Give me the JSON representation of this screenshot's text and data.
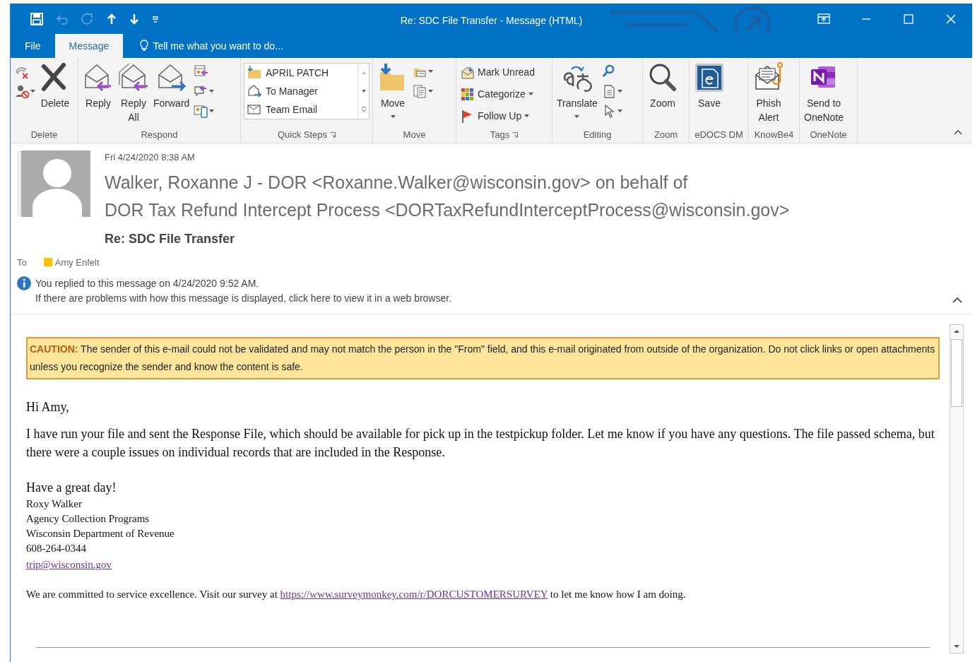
{
  "window": {
    "title": "Re: SDC File Transfer - Message (HTML)"
  },
  "tabs": [
    {
      "label": "File",
      "selected": false
    },
    {
      "label": "Message",
      "selected": true
    }
  ],
  "tell_me": "Tell me what you want to do...",
  "ribbon": [
    {
      "group": "Delete",
      "launcher": false,
      "items": [
        {
          "kind": "icon",
          "dropdown": false
        },
        {
          "kind": "icon",
          "dropdown": true
        },
        {
          "kind": "large",
          "label": "Delete",
          "dropdown": false
        }
      ]
    },
    {
      "group": "Respond",
      "launcher": false,
      "items": [
        {
          "kind": "large",
          "label": "Reply",
          "dropdown": false
        },
        {
          "kind": "large",
          "label": "Reply\nAll",
          "dropdown": false
        },
        {
          "kind": "large",
          "label": "Forward",
          "dropdown": false
        },
        {
          "kind": "icon",
          "dropdown": false
        },
        {
          "kind": "icon",
          "dropdown": true
        },
        {
          "kind": "icon",
          "dropdown": true
        }
      ]
    },
    {
      "group": "Quick Steps",
      "launcher": true,
      "items": [
        {
          "kind": "quickstep",
          "label": "APRIL PATCH"
        },
        {
          "kind": "quickstep",
          "label": "To Manager"
        },
        {
          "kind": "quickstep",
          "label": "Team Email"
        }
      ]
    },
    {
      "group": "Move",
      "launcher": false,
      "items": [
        {
          "kind": "large",
          "label": "Move",
          "dropdown": true
        },
        {
          "kind": "icon",
          "dropdown": true
        },
        {
          "kind": "icon",
          "dropdown": true
        }
      ]
    },
    {
      "group": "Tags",
      "launcher": true,
      "items": [
        {
          "kind": "small",
          "label": "Mark Unread",
          "dropdown": false
        },
        {
          "kind": "small",
          "label": "Categorize",
          "dropdown": true
        },
        {
          "kind": "small",
          "label": "Follow Up",
          "dropdown": true
        }
      ]
    },
    {
      "group": "Editing",
      "launcher": false,
      "items": [
        {
          "kind": "large",
          "label": "Translate",
          "dropdown": true
        },
        {
          "kind": "icon",
          "dropdown": false
        },
        {
          "kind": "icon",
          "dropdown": true
        },
        {
          "kind": "icon",
          "dropdown": true
        }
      ]
    },
    {
      "group": "Zoom",
      "launcher": false,
      "items": [
        {
          "kind": "large",
          "label": "Zoom",
          "dropdown": false
        }
      ]
    },
    {
      "group": "eDOCS DM",
      "launcher": false,
      "items": [
        {
          "kind": "large",
          "label": "Save",
          "dropdown": false
        }
      ]
    },
    {
      "group": "KnowBe4",
      "launcher": false,
      "items": [
        {
          "kind": "large",
          "label": "Phish\nAlert",
          "dropdown": false
        }
      ]
    },
    {
      "group": "OneNote",
      "launcher": false,
      "items": [
        {
          "kind": "large",
          "label": "Send to\nOneNote",
          "dropdown": false
        }
      ]
    }
  ],
  "message": {
    "date": "Fri 4/24/2020 8:38 AM",
    "from": [
      "Walker, Roxanne J - DOR <Roxanne.Walker@wisconsin.gov> on behalf of",
      "DOR Tax Refund Intercept Process <DORTaxRefundInterceptProcess@wisconsin.gov>"
    ],
    "subject": "Re: SDC File Transfer",
    "to_label": "To",
    "recipients": [
      {
        "name": "Amy Enfelt",
        "color": "#ffc000"
      }
    ],
    "info": [
      "You replied to this message on 4/24/2020 9:52 AM.",
      "If there are problems with how this message is displayed, click here to view it in a web browser."
    ]
  },
  "body": {
    "caution": "**CAUTION:** The sender of this e-mail could not be validated and may not match the person in the \"From\" field, and this e-mail originated from outside of the organization. Do not click links or open attachments unless you recognize the sender and know the content is safe.",
    "greeting": "Hi Amy,",
    "paragraphs": [
      "I have run your file and sent the Response File, which should be available for pick up in the testpickup folder. Let me know if you have any questions. The file passed schema, but there were a couple issues on individual records that are included in the Response."
    ],
    "closing": "Have a great day!",
    "signature": [
      "Roxy Walker",
      "Agency Collection Programs",
      "Wisconsin Department of Revenue",
      "608-264-0344"
    ],
    "signature_link": "trip@wisconsin.gov",
    "survey": {
      "before": "We are committed to service excellence.  Visit our survey at ",
      "link": "https://www.surveymonkey.com/r/DORCUSTOMERSURVEY",
      "after": " to let me know how I am doing."
    }
  }
}
